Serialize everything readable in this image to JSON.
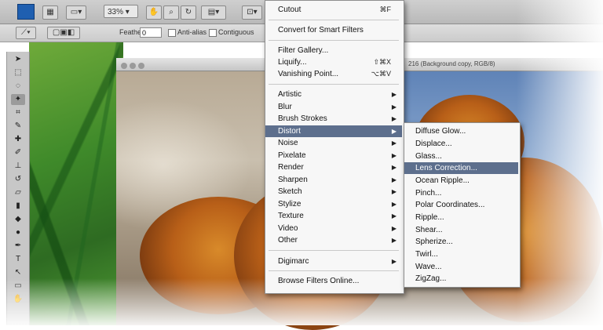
{
  "toolbar": {
    "zoom_value": "33% ▾"
  },
  "options_bar": {
    "feather_label": "Feather:",
    "feather_value": "0",
    "anti_alias_label": "Anti-alias",
    "contiguous_label": "Contiguous"
  },
  "document": {
    "title": "216 (Background copy, RGB/8)"
  },
  "filter_menu": {
    "items": [
      {
        "label": "Cutout",
        "shortcut": "⌘F"
      },
      {
        "label": "Convert for Smart Filters"
      },
      {
        "label": "Filter Gallery..."
      },
      {
        "label": "Liquify...",
        "shortcut": "⇧⌘X"
      },
      {
        "label": "Vanishing Point...",
        "shortcut": "⌥⌘V"
      },
      {
        "label": "Artistic"
      },
      {
        "label": "Blur"
      },
      {
        "label": "Brush Strokes"
      },
      {
        "label": "Distort"
      },
      {
        "label": "Noise"
      },
      {
        "label": "Pixelate"
      },
      {
        "label": "Render"
      },
      {
        "label": "Sharpen"
      },
      {
        "label": "Sketch"
      },
      {
        "label": "Stylize"
      },
      {
        "label": "Texture"
      },
      {
        "label": "Video"
      },
      {
        "label": "Other"
      },
      {
        "label": "Digimarc"
      },
      {
        "label": "Browse Filters Online..."
      }
    ],
    "submenu_arrow": "▶"
  },
  "distort_menu": {
    "items": [
      {
        "label": "Diffuse Glow..."
      },
      {
        "label": "Displace..."
      },
      {
        "label": "Glass..."
      },
      {
        "label": "Lens Correction..."
      },
      {
        "label": "Ocean Ripple..."
      },
      {
        "label": "Pinch..."
      },
      {
        "label": "Polar Coordinates..."
      },
      {
        "label": "Ripple..."
      },
      {
        "label": "Shear..."
      },
      {
        "label": "Spherize..."
      },
      {
        "label": "Twirl..."
      },
      {
        "label": "Wave..."
      },
      {
        "label": "ZigZag..."
      }
    ]
  },
  "colors": {
    "highlight": "#5d6f8d",
    "menu_bg": "#f7f7f7",
    "foliage": "#d88a2a"
  }
}
